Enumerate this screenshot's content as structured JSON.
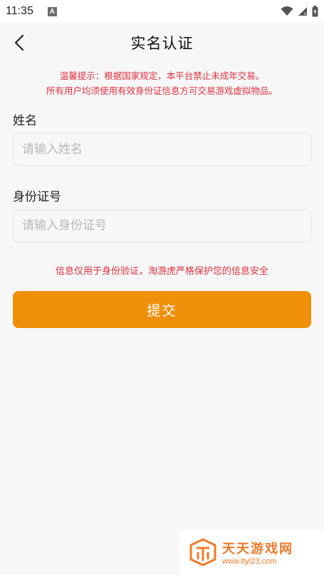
{
  "status_bar": {
    "time": "11:35",
    "notification_letter": "A"
  },
  "header": {
    "title": "实名认证"
  },
  "notice": {
    "line1": "温馨提示：根据国家规定，本平台禁止未成年交易。",
    "line2": "所有用户均须使用有效身份证信息方可交易游戏虚拟物品。"
  },
  "form": {
    "name_label": "姓名",
    "name_placeholder": "请输入姓名",
    "name_value": "",
    "id_label": "身份证号",
    "id_placeholder": "请输入身份证号",
    "id_value": ""
  },
  "privacy_note": "信息仅用于身份验证，淘游虎严格保护您的信息安全",
  "submit_label": "提交",
  "watermark": {
    "title": "天天游戏网",
    "url": "www.ttyl23.com"
  },
  "colors": {
    "accent": "#f0900a",
    "warning_text": "#e0303f",
    "background": "#f7f7f7"
  }
}
